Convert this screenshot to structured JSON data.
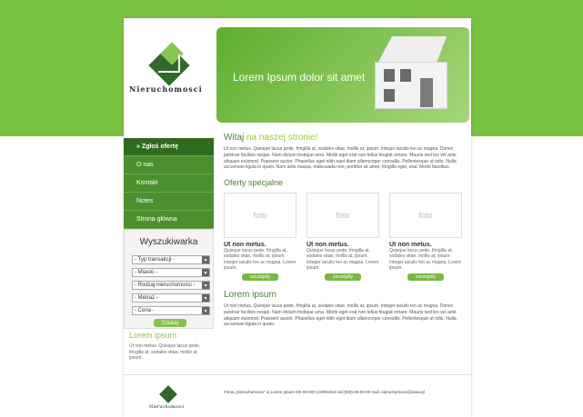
{
  "brand": {
    "name": "Nieruchomosci"
  },
  "banner": {
    "title": "Lorem Ipsum dolor sit amet"
  },
  "menu": [
    {
      "label": "» Zgłoś ofertę",
      "active": true
    },
    {
      "label": "O nas",
      "active": false
    },
    {
      "label": "Kontakt",
      "active": false
    },
    {
      "label": "Notes",
      "active": false
    },
    {
      "label": "Strona główna",
      "active": false
    }
  ],
  "search": {
    "title": "Wyszukiwarka",
    "fields": [
      "- Typ transakcji -",
      "- Miasto -",
      "- Rodzaj nieruchomości -",
      "- Metraż -",
      "- Cena -"
    ],
    "button": "Szukaj"
  },
  "main": {
    "heading": {
      "prefix": "Witaj ",
      "accent": "na naszej stronie!"
    },
    "text": "Ut non metus. Quisque lacus pede, fringilla at, sodales vitae, mollis at, ipsum. Integer iaculis leo ac magna. Donec pulvinar facilisis neque. Nam dictum tristique urna. Morbi eget erat non tellus feugiat ornare. Mauris sed leo vel ante aliquam euismod. Praesent auctor. Phasellus eget nibh eget diam ullamcorper convallis. Pellentesque ut odio. Nulla accumsan ligula in quam. Nam ante massa, malesuada non, porttitor sit amet, fringilla eget, erat. Morbi faucibus.",
    "offers_title": "Oferty specjalne",
    "cards": [
      {
        "photo": "foto",
        "title": "Ut non metus.",
        "text": "Quisque lacus pede, fringilla at, sodales vitae, mollis at, ipsum. Integer iaculis leo ac magna. Lorem ipsum.",
        "button": "szczegóły"
      },
      {
        "photo": "foto",
        "title": "Ut non metus.",
        "text": "Quisque lacus pede, fringilla at, sodales vitae, mollis at, ipsum. Integer iaculis leo ac magna. Lorem ipsum.",
        "button": "szczegóły"
      },
      {
        "photo": "foto",
        "title": "Ut non metus.",
        "text": "Quisque lacus pede, fringilla at, sodales vitae, mollis at, ipsum. Integer iaculis leo ac magna. Lorem ipsum.",
        "button": "szczegóły"
      }
    ],
    "lorem2": {
      "title": "Lorem ipsum",
      "text": "Ut non metus. Quisque lacus pede, fringilla at, sodales vitae, mollis at, ipsum. Integer iaculis leo ac magna. Donec pulvinar facilisis neque. Nam dictum tristique urna. Morbi eget erat non tellus feugiat ornare. Mauris sed leo vel ante aliquam euismod. Praesent auctor. Phasellus eget nibh eget diam ullamcorper convallis. Pellentesque ut odio. Nulla accumsan ligula in quam."
    }
  },
  "left_lorem": {
    "title": "Lorem ipsum",
    "text": "Ut non metus. Quisque lacus pede, fringilla at, sodales vitae, mollis at, ipsum."
  },
  "footer": {
    "text": "Firma „Nieruchomosci\" ul.Lorem Ipsum 0/0 00-000 LOREMUS tel:(000) 00-00-00 mail: nieruchomosci@www.pl",
    "brand": "Nieruchomosci"
  },
  "colors": {
    "brand_green": "#79c141",
    "dark_green": "#2f6b1f",
    "accent_green": "#9acd32"
  }
}
